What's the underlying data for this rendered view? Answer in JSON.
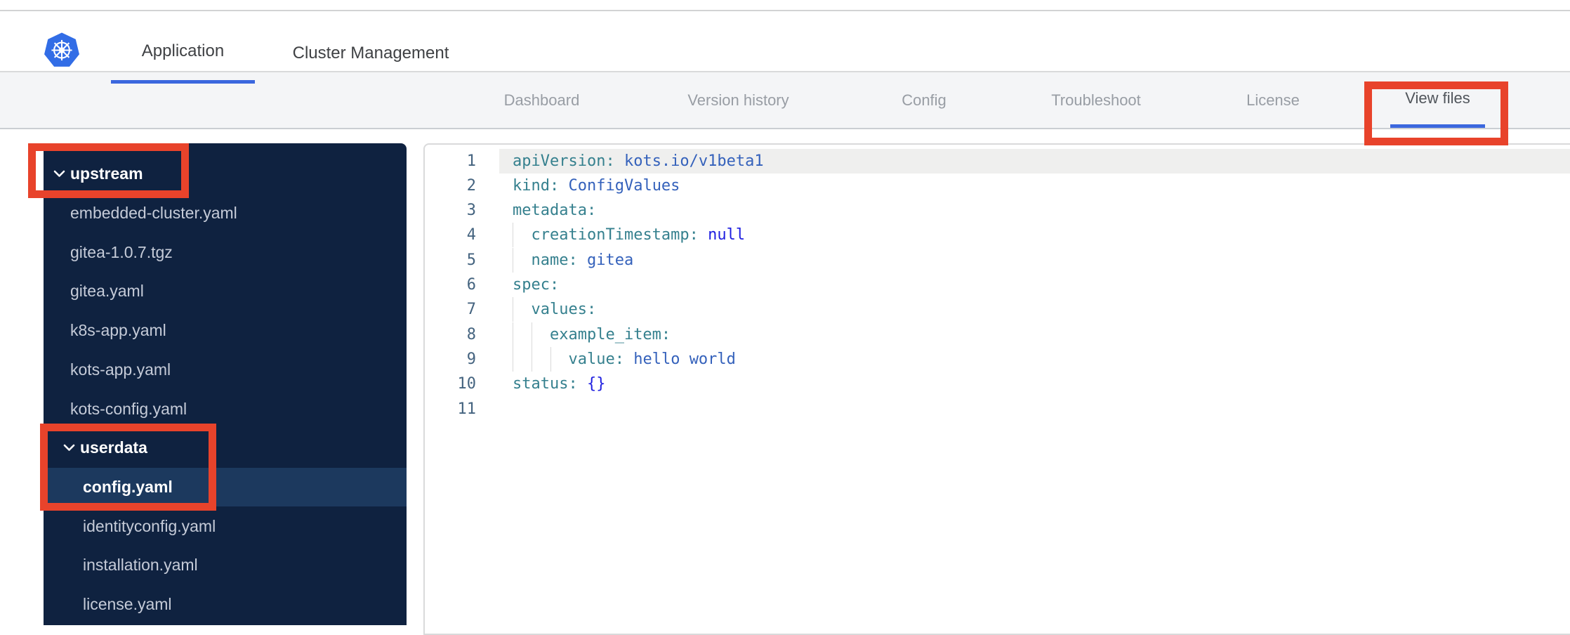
{
  "header": {
    "logo": "kubernetes-logo",
    "tabs": [
      {
        "label": "Application",
        "active": true
      },
      {
        "label": "Cluster Management",
        "active": false
      }
    ]
  },
  "subnav": {
    "tabs": [
      {
        "label": "Dashboard",
        "active": false
      },
      {
        "label": "Version history",
        "active": false
      },
      {
        "label": "Config",
        "active": false
      },
      {
        "label": "Troubleshoot",
        "active": false
      },
      {
        "label": "License",
        "active": false
      },
      {
        "label": "View files",
        "active": true
      }
    ]
  },
  "file_tree": {
    "items": [
      {
        "label": "upstream",
        "type": "folder",
        "level": 0,
        "expanded": true,
        "selected": false
      },
      {
        "label": "embedded-cluster.yaml",
        "type": "file",
        "level": 1,
        "selected": false
      },
      {
        "label": "gitea-1.0.7.tgz",
        "type": "file",
        "level": 1,
        "selected": false
      },
      {
        "label": "gitea.yaml",
        "type": "file",
        "level": 1,
        "selected": false
      },
      {
        "label": "k8s-app.yaml",
        "type": "file",
        "level": 1,
        "selected": false
      },
      {
        "label": "kots-app.yaml",
        "type": "file",
        "level": 1,
        "selected": false
      },
      {
        "label": "kots-config.yaml",
        "type": "file",
        "level": 1,
        "selected": false
      },
      {
        "label": "userdata",
        "type": "folder",
        "level": 1,
        "expanded": true,
        "selected": false
      },
      {
        "label": "config.yaml",
        "type": "file",
        "level": 2,
        "selected": true
      },
      {
        "label": "identityconfig.yaml",
        "type": "file",
        "level": 2,
        "selected": false
      },
      {
        "label": "installation.yaml",
        "type": "file",
        "level": 2,
        "selected": false
      },
      {
        "label": "license.yaml",
        "type": "file",
        "level": 2,
        "selected": false
      }
    ]
  },
  "editor": {
    "language": "yaml",
    "lines": [
      {
        "n": 1,
        "active": true,
        "guides": [],
        "tokens": [
          {
            "t": "apiVersion:",
            "c": "k"
          },
          {
            "t": " ",
            "c": "p"
          },
          {
            "t": "kots.io/v1beta1",
            "c": "s"
          }
        ]
      },
      {
        "n": 2,
        "active": false,
        "guides": [],
        "tokens": [
          {
            "t": "kind:",
            "c": "k"
          },
          {
            "t": " ",
            "c": "p"
          },
          {
            "t": "ConfigValues",
            "c": "s"
          }
        ]
      },
      {
        "n": 3,
        "active": false,
        "guides": [],
        "tokens": [
          {
            "t": "metadata:",
            "c": "k"
          }
        ]
      },
      {
        "n": 4,
        "active": false,
        "guides": [
          0
        ],
        "tokens": [
          {
            "t": "  ",
            "c": "p"
          },
          {
            "t": "creationTimestamp:",
            "c": "k"
          },
          {
            "t": " ",
            "c": "p"
          },
          {
            "t": "null",
            "c": "c"
          }
        ]
      },
      {
        "n": 5,
        "active": false,
        "guides": [
          0
        ],
        "tokens": [
          {
            "t": "  ",
            "c": "p"
          },
          {
            "t": "name:",
            "c": "k"
          },
          {
            "t": " ",
            "c": "p"
          },
          {
            "t": "gitea",
            "c": "s"
          }
        ]
      },
      {
        "n": 6,
        "active": false,
        "guides": [],
        "tokens": [
          {
            "t": "spec:",
            "c": "k"
          }
        ]
      },
      {
        "n": 7,
        "active": false,
        "guides": [
          0
        ],
        "tokens": [
          {
            "t": "  ",
            "c": "p"
          },
          {
            "t": "values:",
            "c": "k"
          }
        ]
      },
      {
        "n": 8,
        "active": false,
        "guides": [
          0,
          1
        ],
        "tokens": [
          {
            "t": "    ",
            "c": "p"
          },
          {
            "t": "example_item:",
            "c": "k"
          }
        ]
      },
      {
        "n": 9,
        "active": false,
        "guides": [
          0,
          1,
          2
        ],
        "tokens": [
          {
            "t": "      ",
            "c": "p"
          },
          {
            "t": "value:",
            "c": "k"
          },
          {
            "t": " ",
            "c": "p"
          },
          {
            "t": "hello world",
            "c": "s"
          }
        ]
      },
      {
        "n": 10,
        "active": false,
        "guides": [],
        "tokens": [
          {
            "t": "status:",
            "c": "k"
          },
          {
            "t": " ",
            "c": "p"
          },
          {
            "t": "{}",
            "c": "c"
          }
        ]
      },
      {
        "n": 11,
        "active": false,
        "guides": [],
        "tokens": []
      }
    ]
  },
  "annotations": {
    "color": "#e8432b",
    "boxes": [
      {
        "target": "upstream-folder"
      },
      {
        "target": "userdata-and-config-yaml"
      },
      {
        "target": "view-files-tab"
      }
    ]
  },
  "colors": {
    "accent_blue": "#3b67de",
    "k8s_blue": "#326de6",
    "sidebar_bg": "#0f2240",
    "sidebar_selected_row": "#1c395e",
    "subnav_bg": "#f4f5f7",
    "code_key": "#35808e",
    "code_string": "#3461bb",
    "code_constant": "#1f1fe0",
    "line_number": "#44637f",
    "annotation_red": "#e8432b"
  }
}
